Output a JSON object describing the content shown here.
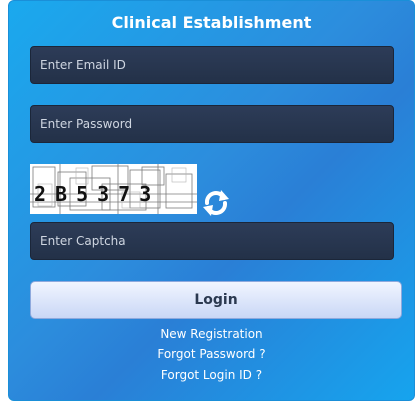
{
  "panel": {
    "title": "Clinical Establishment"
  },
  "form": {
    "email_placeholder": "Enter Email ID",
    "password_placeholder": "Enter Password",
    "captcha_code": "2B5373",
    "captcha_placeholder": "Enter Captcha",
    "refresh_icon": "refresh-icon",
    "login_label": "Login"
  },
  "links": {
    "new_registration": "New Registration",
    "forgot_password": "Forgot Password ?",
    "forgot_login": "Forgot Login ID ?"
  },
  "colors": {
    "panel_gradient_start": "#1aa9ee",
    "panel_gradient_mid": "#2a7fd6",
    "field_bg": "#2d3c58",
    "login_button_bg": "#dbe5fb"
  }
}
